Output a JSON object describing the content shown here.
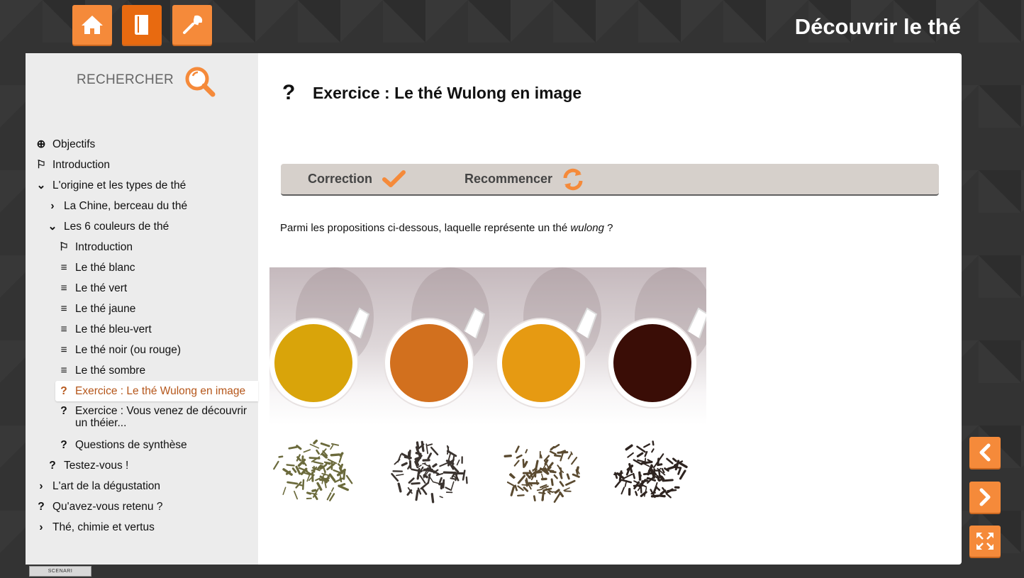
{
  "header": {
    "title": "Découvrir le thé",
    "buttons": [
      {
        "name": "home",
        "icon": "home-icon"
      },
      {
        "name": "book",
        "icon": "book-icon"
      },
      {
        "name": "tools",
        "icon": "wrench-icon"
      }
    ]
  },
  "search": {
    "label": "RECHERCHER",
    "icon": "magnifier-icon"
  },
  "nav": {
    "objectifs": "Objectifs",
    "introduction": "Introduction",
    "origine": "L'origine et les types de thé",
    "chine": "La Chine, berceau du thé",
    "couleurs": "Les 6 couleurs de thé",
    "intro2": "Introduction",
    "blanc": "Le thé blanc",
    "vert": "Le thé vert",
    "jaune": "Le thé jaune",
    "bleuvert": "Le thé bleu-vert",
    "noir": "Le thé noir (ou rouge)",
    "sombre": "Le thé sombre",
    "exercice_wulong": "Exercice : Le thé Wulong en image",
    "exercice_theier_1": "Exercice : Vous venez de découvrir",
    "exercice_theier_2": "un théier...",
    "synthese": "Questions de synthèse",
    "testez": "Testez-vous !",
    "degustation": "L'art de la dégustation",
    "retenu": "Qu'avez-vous retenu ?",
    "chimie": "Thé, chimie et vertus"
  },
  "content": {
    "title": "Exercice : Le thé Wulong en image",
    "toolbar": {
      "correction": "Correction",
      "recommencer": "Recommencer"
    },
    "question_before": "Parmi les propositions ci-dessous, laquelle représente un thé ",
    "question_em": "wulong",
    "question_after": " ?",
    "cups": [
      {
        "color": "#d9a40a"
      },
      {
        "color": "#d2701e"
      },
      {
        "color": "#e69a12"
      },
      {
        "color": "#3a0d06"
      }
    ]
  },
  "footer": {
    "badge": "SCENARI"
  },
  "colors": {
    "accent": "#f58a3a",
    "current": "#b5561a"
  }
}
